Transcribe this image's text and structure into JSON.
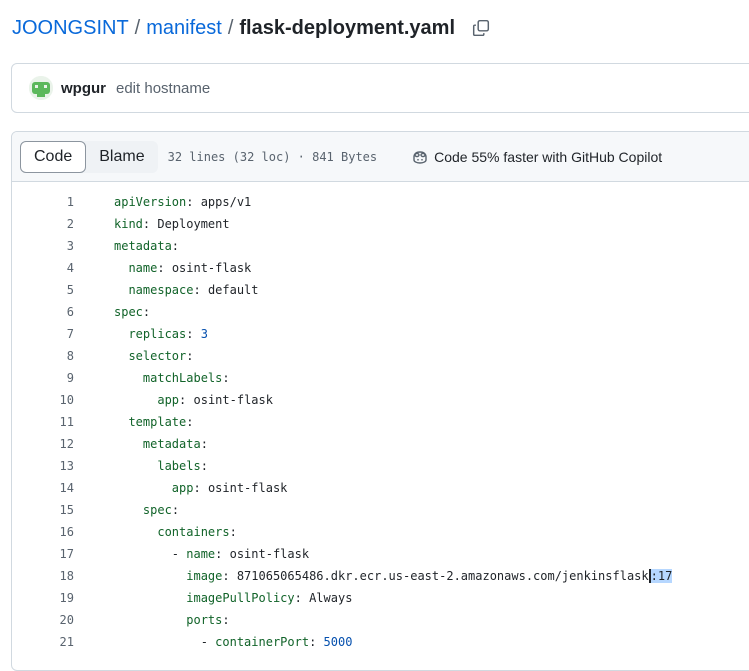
{
  "breadcrumb": {
    "owner": "JOONGSINT",
    "repo": "manifest",
    "separator": "/",
    "file": "flask-deployment.yaml"
  },
  "commit": {
    "author": "wpgur",
    "message": "edit hostname"
  },
  "file_header": {
    "tabs": [
      "Code",
      "Blame"
    ],
    "active_tab": "Code",
    "meta": "32 lines (32 loc) · 841 Bytes",
    "copilot_text": "Code 55% faster with GitHub Copilot"
  },
  "colors": {
    "link": "#0969da",
    "yaml_key": "#116329",
    "number": "#0550ae",
    "selection": "#b6d7ff"
  },
  "code_lines": [
    {
      "n": "1",
      "indent": "",
      "key": "apiVersion",
      "val": "apps/v1"
    },
    {
      "n": "2",
      "indent": "",
      "key": "kind",
      "val": "Deployment"
    },
    {
      "n": "3",
      "indent": "",
      "key": "metadata",
      "val": ""
    },
    {
      "n": "4",
      "indent": "  ",
      "key": "name",
      "val": "osint-flask"
    },
    {
      "n": "5",
      "indent": "  ",
      "key": "namespace",
      "val": "default"
    },
    {
      "n": "6",
      "indent": "",
      "key": "spec",
      "val": ""
    },
    {
      "n": "7",
      "indent": "  ",
      "key": "replicas",
      "val": "3",
      "num": true
    },
    {
      "n": "8",
      "indent": "  ",
      "key": "selector",
      "val": ""
    },
    {
      "n": "9",
      "indent": "    ",
      "key": "matchLabels",
      "val": ""
    },
    {
      "n": "10",
      "indent": "      ",
      "key": "app",
      "val": "osint-flask"
    },
    {
      "n": "11",
      "indent": "  ",
      "key": "template",
      "val": ""
    },
    {
      "n": "12",
      "indent": "    ",
      "key": "metadata",
      "val": ""
    },
    {
      "n": "13",
      "indent": "      ",
      "key": "labels",
      "val": ""
    },
    {
      "n": "14",
      "indent": "        ",
      "key": "app",
      "val": "osint-flask"
    },
    {
      "n": "15",
      "indent": "    ",
      "key": "spec",
      "val": ""
    },
    {
      "n": "16",
      "indent": "      ",
      "key": "containers",
      "val": ""
    },
    {
      "n": "17",
      "indent": "        - ",
      "key": "name",
      "val": "osint-flask"
    },
    {
      "n": "18",
      "indent": "          ",
      "key": "image",
      "val": "871065065486.dkr.ecr.us-east-2.amazonaws.com/jenkinsflask",
      "sel": ":17"
    },
    {
      "n": "19",
      "indent": "          ",
      "key": "imagePullPolicy",
      "val": "Always"
    },
    {
      "n": "20",
      "indent": "          ",
      "key": "ports",
      "val": ""
    },
    {
      "n": "21",
      "indent": "            - ",
      "key": "containerPort",
      "val": "5000",
      "num": true
    }
  ]
}
